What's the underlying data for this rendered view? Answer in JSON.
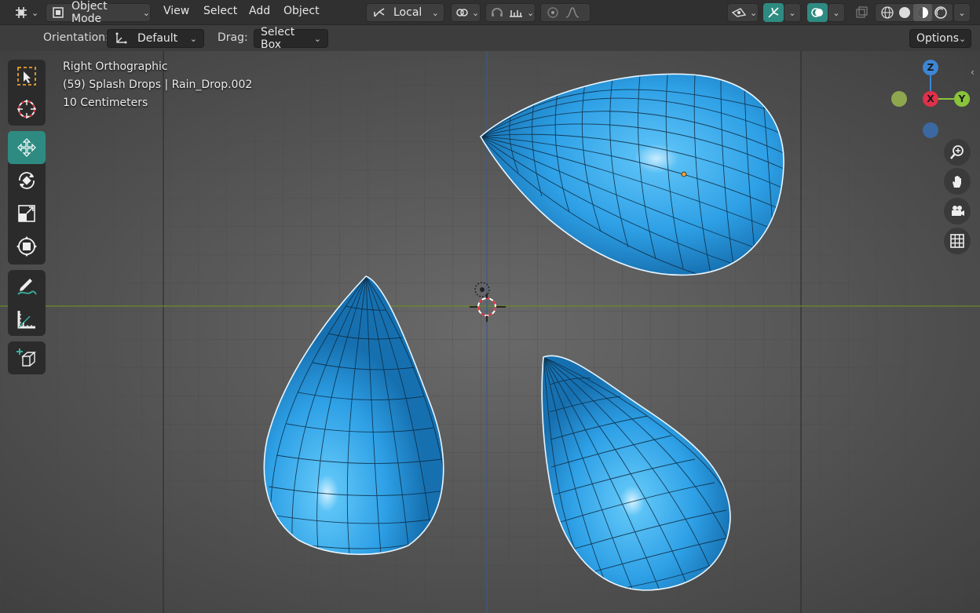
{
  "header": {
    "mode_label": "Object Mode",
    "menus": [
      "View",
      "Select",
      "Add",
      "Object"
    ],
    "transform_orientation": "Local"
  },
  "tool_settings": {
    "orientation_label": "Orientation:",
    "orientation_value": "Default",
    "drag_label": "Drag:",
    "drag_value": "Select Box",
    "options_label": "Options"
  },
  "viewport": {
    "view_name": "Right Orthographic",
    "object_info": "(59) Splash Drops | Rain_Drop.002",
    "scale_text": "10 Centimeters"
  },
  "gizmo": {
    "axes": [
      "Z",
      "X",
      "Y"
    ],
    "colors": {
      "z": "#3d86d6",
      "x": "#e0304a",
      "y": "#8ac43a",
      "neg_y": "#8ea64e",
      "neg_z": "#3b68a0"
    }
  },
  "colors": {
    "accent": "#2e8b82",
    "viewport_bg": "#3d3d3d",
    "drop_fill": "#2ea0e6",
    "grid_x_axis": "#6a8a2a",
    "grid_z_axis": "#3a5a8a"
  },
  "toolbar": {
    "tools": [
      "select-box",
      "cursor",
      "move",
      "rotate",
      "scale",
      "transform",
      "annotate",
      "measure",
      "add-cube"
    ],
    "active_tool": "move"
  }
}
